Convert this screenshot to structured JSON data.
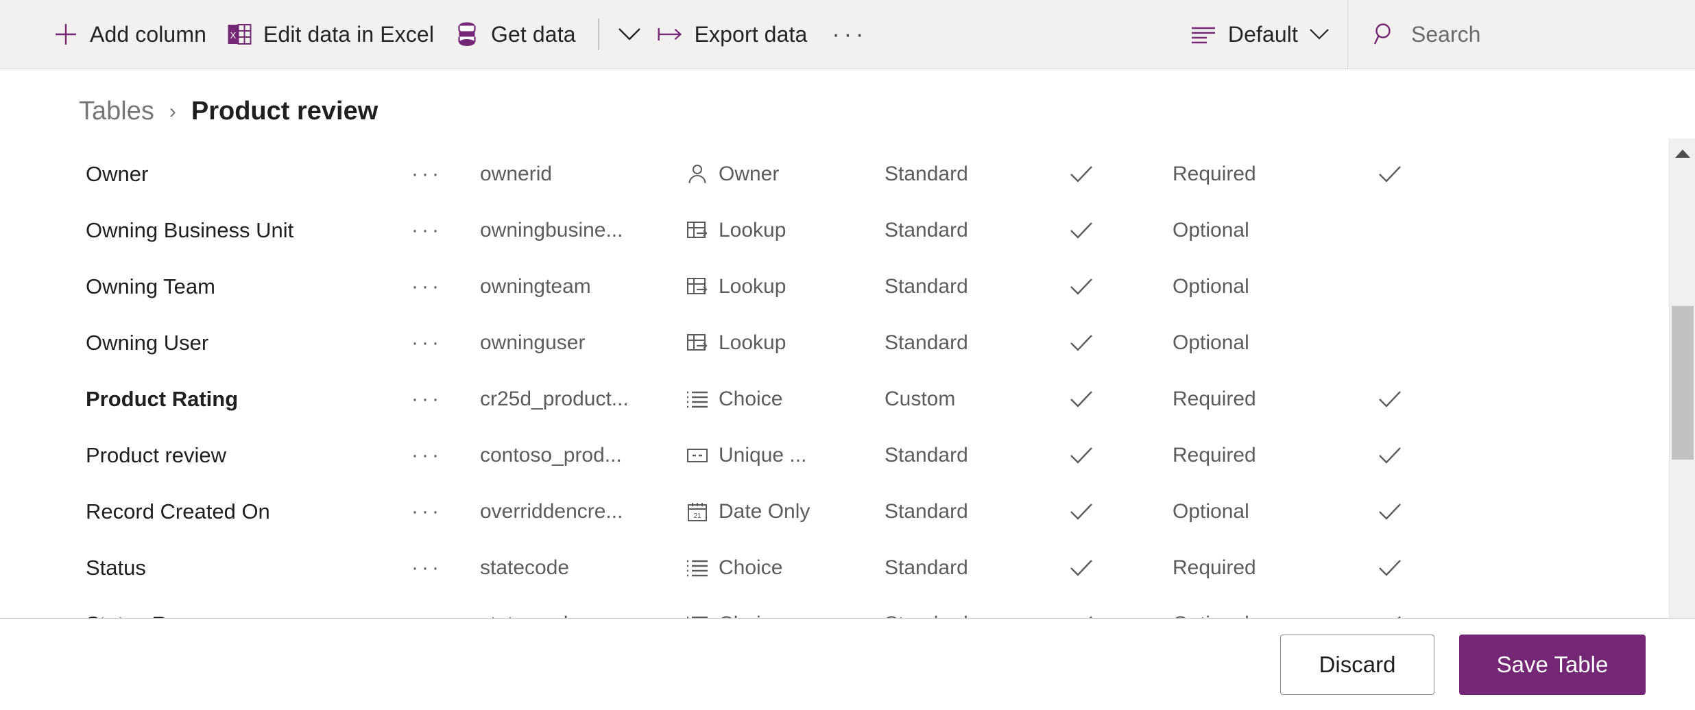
{
  "commandbar": {
    "items": [
      {
        "id": "add-column",
        "label": "Add column",
        "icon": "plus-icon"
      },
      {
        "id": "edit-in-excel",
        "label": "Edit data in Excel",
        "icon": "excel-icon"
      },
      {
        "id": "get-data",
        "label": "Get data",
        "icon": "database-icon"
      },
      {
        "id": "export-data",
        "label": "Export data",
        "icon": "export-arrow-icon"
      }
    ],
    "overflow_label": "···",
    "view": {
      "label": "Default",
      "icon": "view-lines-icon",
      "chevron": "chevron-down-icon"
    },
    "search": {
      "placeholder": "Search",
      "icon": "search-icon"
    }
  },
  "breadcrumb": {
    "parent": "Tables",
    "separator": "›",
    "current": "Product review"
  },
  "grid": {
    "menu_glyph": "···",
    "check_glyph": "check-icon",
    "rows": [
      {
        "display_name": "Owner",
        "logical_name": "ownerid",
        "data_type": "Owner",
        "type_icon": "person-icon",
        "custom": "Standard",
        "searchable": true,
        "required": "Required",
        "last_check": true,
        "modified": false
      },
      {
        "display_name": "Owning Business Unit",
        "logical_name": "owningbusine...",
        "data_type": "Lookup",
        "type_icon": "lookup-icon",
        "custom": "Standard",
        "searchable": true,
        "required": "Optional",
        "last_check": false,
        "modified": false
      },
      {
        "display_name": "Owning Team",
        "logical_name": "owningteam",
        "data_type": "Lookup",
        "type_icon": "lookup-icon",
        "custom": "Standard",
        "searchable": true,
        "required": "Optional",
        "last_check": false,
        "modified": false
      },
      {
        "display_name": "Owning User",
        "logical_name": "owninguser",
        "data_type": "Lookup",
        "type_icon": "lookup-icon",
        "custom": "Standard",
        "searchable": true,
        "required": "Optional",
        "last_check": false,
        "modified": false
      },
      {
        "display_name": "Product Rating",
        "logical_name": "cr25d_product...",
        "data_type": "Choice",
        "type_icon": "choice-icon",
        "custom": "Custom",
        "searchable": true,
        "required": "Required",
        "last_check": true,
        "modified": true
      },
      {
        "display_name": "Product review",
        "logical_name": "contoso_prod...",
        "data_type": "Unique ...",
        "type_icon": "unique-icon",
        "custom": "Standard",
        "searchable": true,
        "required": "Required",
        "last_check": true,
        "modified": false
      },
      {
        "display_name": "Record Created On",
        "logical_name": "overriddencre...",
        "data_type": "Date Only",
        "type_icon": "calendar-icon",
        "custom": "Standard",
        "searchable": true,
        "required": "Optional",
        "last_check": true,
        "modified": false
      },
      {
        "display_name": "Status",
        "logical_name": "statecode",
        "data_type": "Choice",
        "type_icon": "choice-icon",
        "custom": "Standard",
        "searchable": true,
        "required": "Required",
        "last_check": true,
        "modified": false
      },
      {
        "display_name": "Status Reason",
        "logical_name": "statuscode",
        "data_type": "Choice",
        "type_icon": "choice-icon",
        "custom": "Standard",
        "searchable": true,
        "required": "Optional",
        "last_check": true,
        "modified": false
      }
    ]
  },
  "footer": {
    "discard_label": "Discard",
    "save_label": "Save Table"
  },
  "colors": {
    "accent": "#742774",
    "commandbar_bg": "#f2f1f0",
    "text": "#1f1f1f",
    "muted_text": "#5c5c5c",
    "scrollbar_thumb": "#c2c2c2"
  }
}
